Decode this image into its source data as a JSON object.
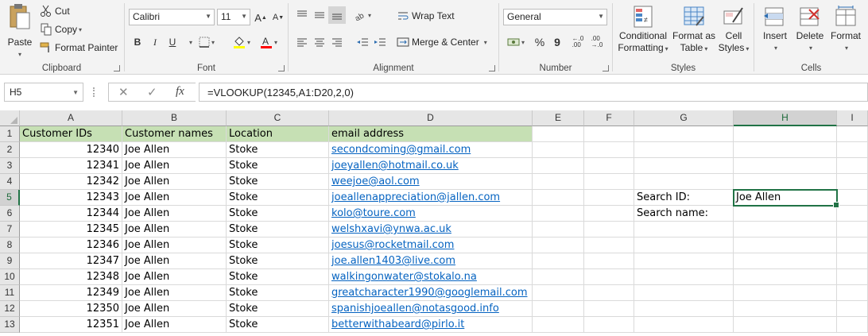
{
  "ribbon": {
    "clipboard": {
      "paste": "Paste",
      "cut": "Cut",
      "copy": "Copy",
      "format_painter": "Format Painter",
      "label": "Clipboard"
    },
    "font": {
      "font_name": "Calibri",
      "font_size": "11",
      "bold": "B",
      "italic": "I",
      "underline": "U",
      "label": "Font"
    },
    "alignment": {
      "wrap_text": "Wrap Text",
      "merge_center": "Merge & Center",
      "label": "Alignment"
    },
    "number": {
      "format": "General",
      "percent": "%",
      "comma": "9",
      "label": "Number"
    },
    "styles": {
      "conditional": "Conditional",
      "conditional2": "Formatting",
      "format_as": "Format as",
      "format_as2": "Table",
      "cell": "Cell",
      "cell2": "Styles",
      "label": "Styles"
    },
    "cells": {
      "insert": "Insert",
      "delete": "Delete",
      "format": "Format",
      "label": "Cells"
    }
  },
  "formula_bar": {
    "name_box": "H5",
    "formula": "=VLOOKUP(12345,A1:D20,2,0)"
  },
  "sheet": {
    "columns": [
      "A",
      "B",
      "C",
      "D",
      "E",
      "F",
      "G",
      "H",
      "I"
    ],
    "rows": [
      "1",
      "2",
      "3",
      "4",
      "5",
      "6",
      "7",
      "8",
      "9",
      "10",
      "11",
      "12",
      "13"
    ],
    "header": [
      "Customer IDs",
      "Customer names",
      "Location",
      "email address"
    ],
    "data": [
      [
        "12340",
        "Joe Allen",
        "Stoke",
        "secondcoming@gmail.com"
      ],
      [
        "12341",
        "Joe Allen",
        "Stoke",
        "joeyallen@hotmail.co.uk"
      ],
      [
        "12342",
        "Joe Allen",
        "Stoke",
        "weejoe@aol.com"
      ],
      [
        "12343",
        "Joe Allen",
        "Stoke",
        "joeallenappreciation@jallen.com"
      ],
      [
        "12344",
        "Joe Allen",
        "Stoke",
        "kolo@toure.com"
      ],
      [
        "12345",
        "Joe Allen",
        "Stoke",
        "welshxavi@ynwa.ac.uk"
      ],
      [
        "12346",
        "Joe Allen",
        "Stoke",
        "joesus@rocketmail.com"
      ],
      [
        "12347",
        "Joe Allen",
        "Stoke",
        "joe.allen1403@live.com"
      ],
      [
        "12348",
        "Joe Allen",
        "Stoke",
        "walkingonwater@stokalo.na"
      ],
      [
        "12349",
        "Joe Allen",
        "Stoke",
        "greatcharacter1990@googlemail.com"
      ],
      [
        "12350",
        "Joe Allen",
        "Stoke",
        "spanishjoeallen@notasgood.info"
      ],
      [
        "12351",
        "Joe Allen",
        "Stoke",
        "betterwithabeard@pirlo.it"
      ]
    ],
    "search_id_label": "Search ID:",
    "search_name_label": "Search name:",
    "result_value": "Joe Allen",
    "selected_cell": "H5"
  },
  "colors": {
    "header_fill": "#c6e0b4",
    "link": "#0563c1",
    "selection": "#217346"
  }
}
